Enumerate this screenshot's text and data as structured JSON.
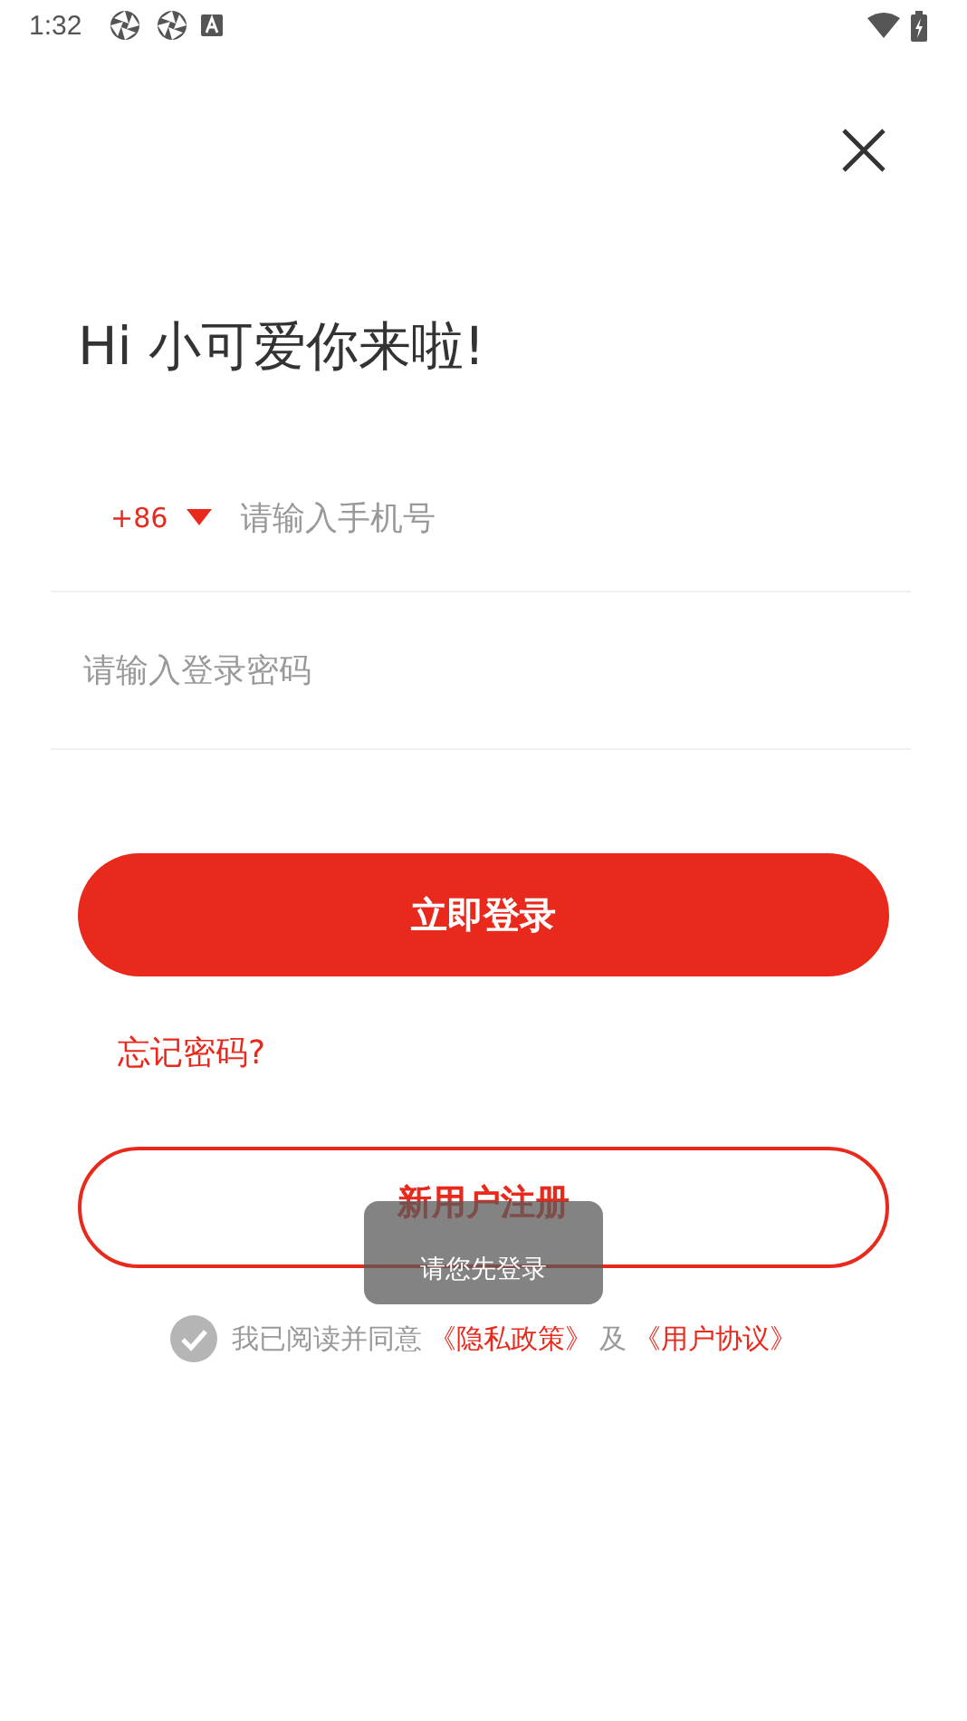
{
  "status_bar": {
    "time": "1:32"
  },
  "greeting": "Hi 小可爱你来啦!",
  "phone_field": {
    "country_code": "+86",
    "placeholder": "请输入手机号"
  },
  "password_field": {
    "placeholder": "请输入登录密码"
  },
  "login_button": "立即登录",
  "forgot_link": "忘记密码?",
  "register_button": "新用户注册",
  "toast": "请您先登录",
  "agreement": {
    "checked": false,
    "text": "我已阅读并同意",
    "privacy_link": "《隐私政策》",
    "joiner": "及",
    "terms_link": "《用户协议》"
  }
}
